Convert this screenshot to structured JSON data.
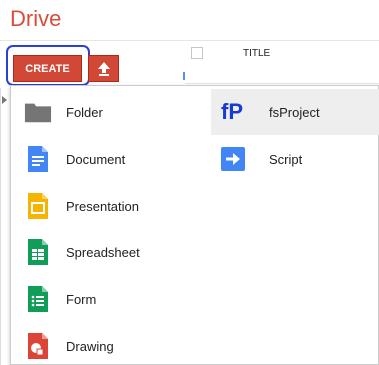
{
  "app": {
    "title": "Drive"
  },
  "toolbar": {
    "create_label": "CREATE",
    "upload_icon": "upload-icon"
  },
  "list_header": {
    "title_column": "TITLE"
  },
  "create_menu": {
    "left_items": [
      {
        "label": "Folder",
        "icon": "folder-icon"
      },
      {
        "label": "Document",
        "icon": "document-icon"
      },
      {
        "label": "Presentation",
        "icon": "presentation-icon"
      },
      {
        "label": "Spreadsheet",
        "icon": "spreadsheet-icon"
      },
      {
        "label": "Form",
        "icon": "form-icon"
      },
      {
        "label": "Drawing",
        "icon": "drawing-icon"
      }
    ],
    "right_items": [
      {
        "label": "fsProject",
        "icon": "fsproject-icon",
        "icon_text": "fP",
        "highlighted": true
      },
      {
        "label": "Script",
        "icon": "script-icon"
      }
    ]
  },
  "colors": {
    "brand_red": "#dd4b39",
    "button_red": "#d14836",
    "focus_ring": "#2a3fd6",
    "doc_blue": "#4285f4",
    "slides_yellow": "#f4b400",
    "sheets_green": "#0f9d58",
    "drawing_red": "#db4437"
  }
}
